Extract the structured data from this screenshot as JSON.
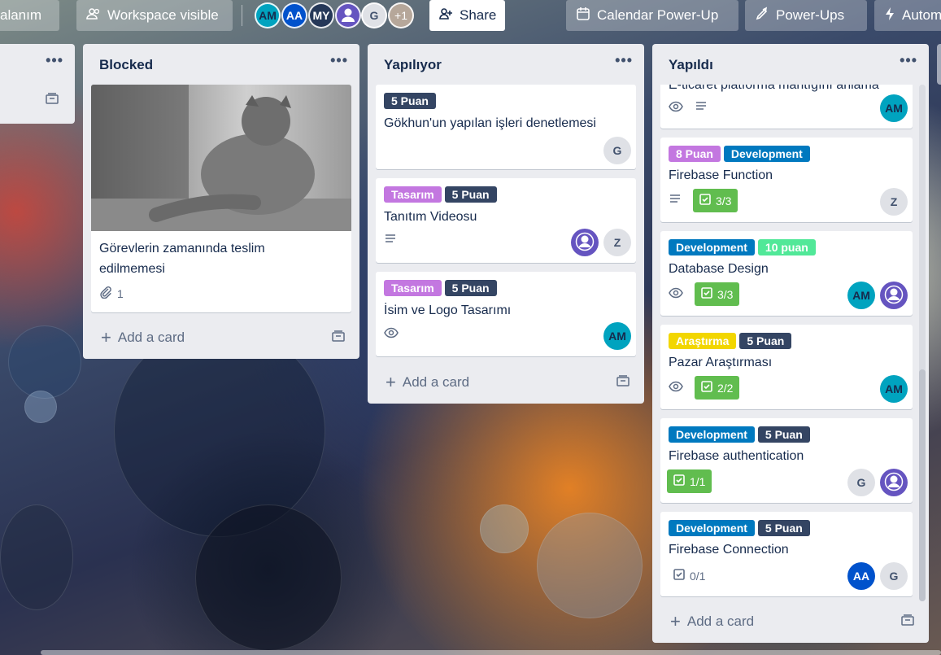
{
  "topbar": {
    "workspace_crumb": "alanım",
    "visibility": "Workspace visible",
    "members": [
      {
        "initials": "AM"
      },
      {
        "initials": "AA"
      },
      {
        "initials": "MY"
      },
      {
        "initials": ""
      },
      {
        "initials": "G"
      }
    ],
    "more_members": "+1",
    "share": "Share",
    "calendar": "Calendar Power-Up",
    "powerups": "Power-Ups",
    "automation": "Autom"
  },
  "lists": {
    "partial": {},
    "blocked": {
      "title": "Blocked",
      "cards": [
        {
          "title": "Görevlerin zamanında teslim edilmemesi",
          "attachments": "1"
        }
      ],
      "add_card": "Add a card"
    },
    "doing": {
      "title": "Yapılıyor",
      "cards": [
        {
          "labels": [
            "5 Puan"
          ],
          "title": "Gökhun'un yapılan işleri denetlemesi",
          "members": [
            "G"
          ]
        },
        {
          "labels": [
            "Tasarım",
            "5 Puan"
          ],
          "title": "Tanıtım Videosu",
          "members": [
            "",
            "Z"
          ]
        },
        {
          "labels": [
            "Tasarım",
            "5 Puan"
          ],
          "title": "İsim ve Logo Tasarımı",
          "members": [
            "AM"
          ]
        }
      ],
      "add_card": "Add a card"
    },
    "done": {
      "title": "Yapıldı",
      "cards": [
        {
          "title": "E-ticaret platforma mantığını anlama",
          "members": [
            "AM"
          ]
        },
        {
          "labels": [
            "8 Puan",
            "Development"
          ],
          "title": "Firebase Function",
          "checklist": "3/3",
          "members": [
            "Z"
          ]
        },
        {
          "labels": [
            "Development",
            "10 puan"
          ],
          "title": "Database Design",
          "checklist": "3/3",
          "members": [
            "AM",
            ""
          ]
        },
        {
          "labels": [
            "Araştırma",
            "5 Puan"
          ],
          "title": "Pazar Araştırması",
          "checklist": "2/2",
          "members": [
            "AM"
          ]
        },
        {
          "labels": [
            "Development",
            "5 Puan"
          ],
          "title": "Firebase authentication",
          "checklist": "1/1",
          "members": [
            "G",
            ""
          ]
        },
        {
          "labels": [
            "Development",
            "5 Puan"
          ],
          "title": "Firebase Connection",
          "checklist": "0/1",
          "members": [
            "AA",
            "G"
          ]
        }
      ],
      "add_card": "Add a card"
    }
  },
  "colors": {
    "label_points": "#344563",
    "label_design": "#c377e0",
    "label_development": "#0079bf",
    "label_research": "#f2d600",
    "label_10": "#51e898",
    "checklist_complete": "#61bd4f"
  }
}
